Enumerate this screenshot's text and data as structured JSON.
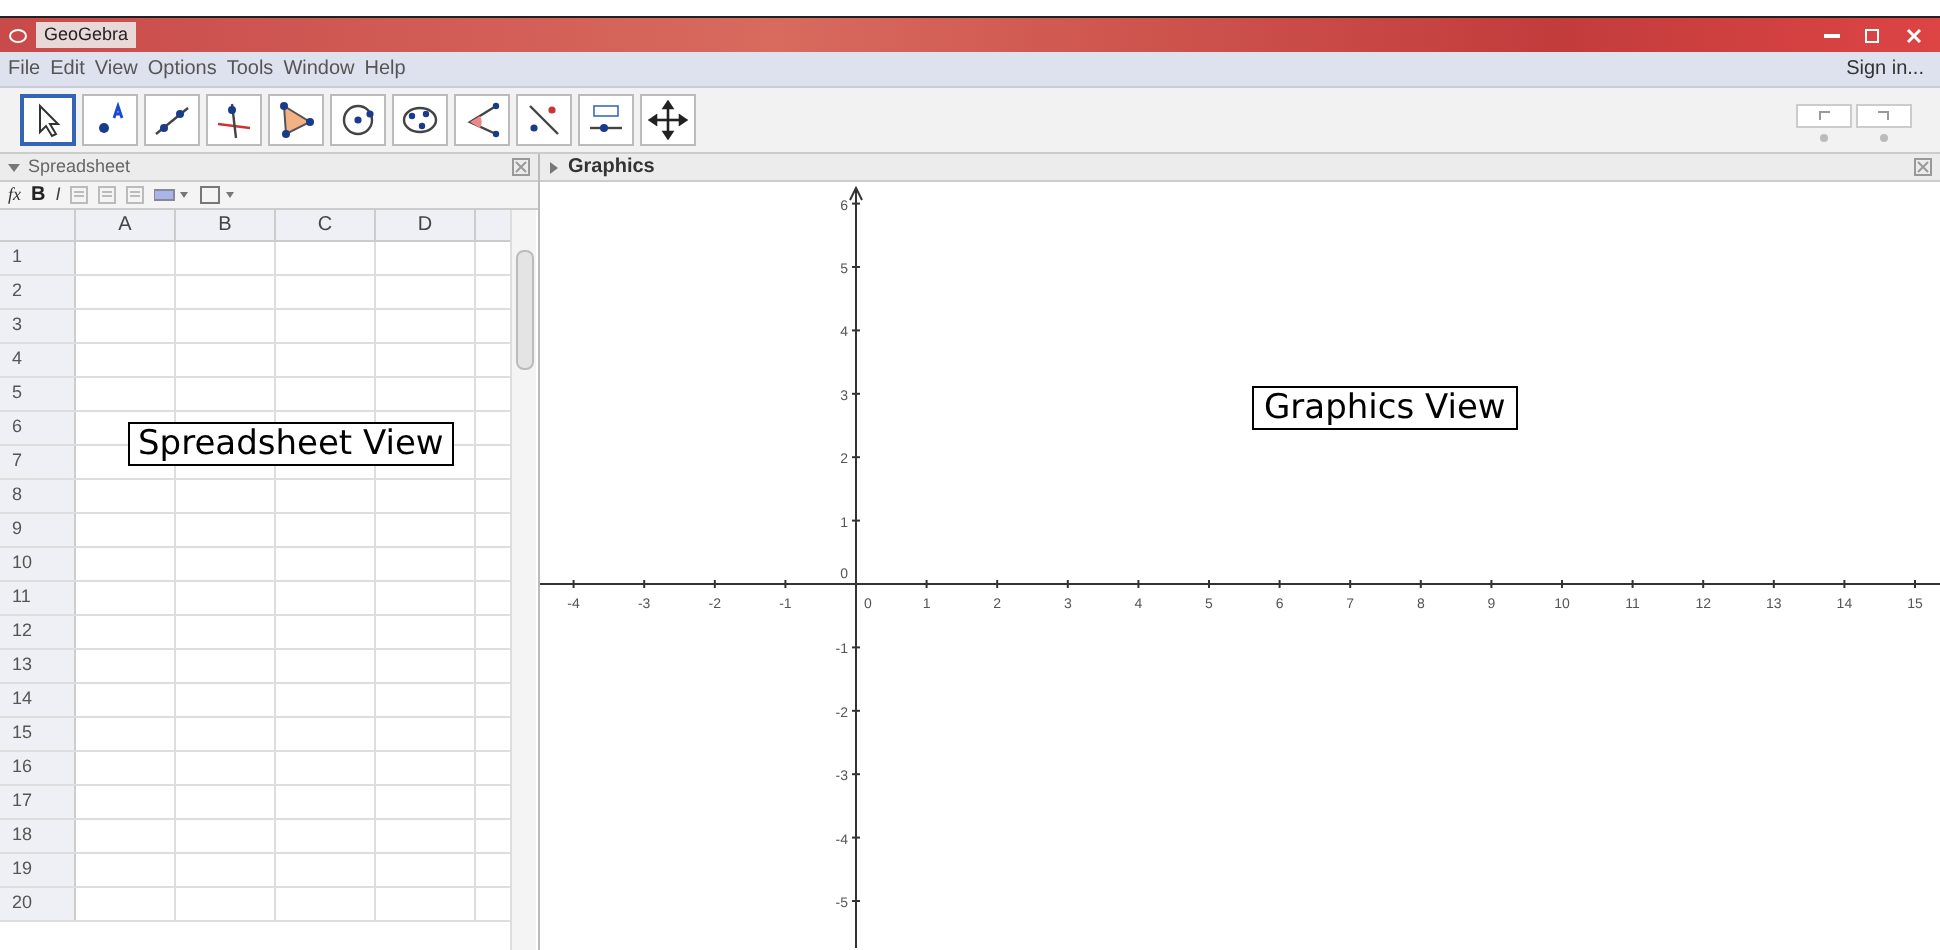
{
  "window": {
    "title": "GeoGebra"
  },
  "menu": [
    "File",
    "Edit",
    "View",
    "Options",
    "Tools",
    "Window",
    "Help"
  ],
  "sign_in": "Sign in...",
  "tools": [
    {
      "kind": "move",
      "selected": true
    },
    {
      "kind": "point",
      "selected": false
    },
    {
      "kind": "line",
      "selected": false
    },
    {
      "kind": "perpendicular",
      "selected": false
    },
    {
      "kind": "polygon",
      "selected": false
    },
    {
      "kind": "circle",
      "selected": false
    },
    {
      "kind": "conic",
      "selected": false
    },
    {
      "kind": "angle",
      "selected": false
    },
    {
      "kind": "reflect",
      "selected": false
    },
    {
      "kind": "slider",
      "selected": false
    },
    {
      "kind": "pan",
      "selected": false
    }
  ],
  "spreadsheet": {
    "title": "Spreadsheet",
    "formula": "fx",
    "bold": "B",
    "italic": "I",
    "columns": [
      "A",
      "B",
      "C",
      "D"
    ],
    "rows": [
      "1",
      "2",
      "3",
      "4",
      "5",
      "6",
      "7",
      "8",
      "9",
      "10",
      "11",
      "12",
      "13",
      "14",
      "15",
      "16",
      "17",
      "18",
      "19",
      "20"
    ],
    "annotation": "Spreadsheet View"
  },
  "graphics": {
    "title": "Graphics",
    "x_ticks": [
      "-4",
      "-3",
      "-2",
      "-1",
      "0",
      "1",
      "2",
      "3",
      "4",
      "5",
      "6",
      "7",
      "8",
      "9",
      "10",
      "11",
      "12",
      "13",
      "14",
      "15"
    ],
    "y_ticks": [
      "6",
      "5",
      "4",
      "3",
      "2",
      "1",
      "0",
      "-1",
      "-2",
      "-3",
      "-4",
      "-5"
    ],
    "annotation": "Graphics View"
  }
}
